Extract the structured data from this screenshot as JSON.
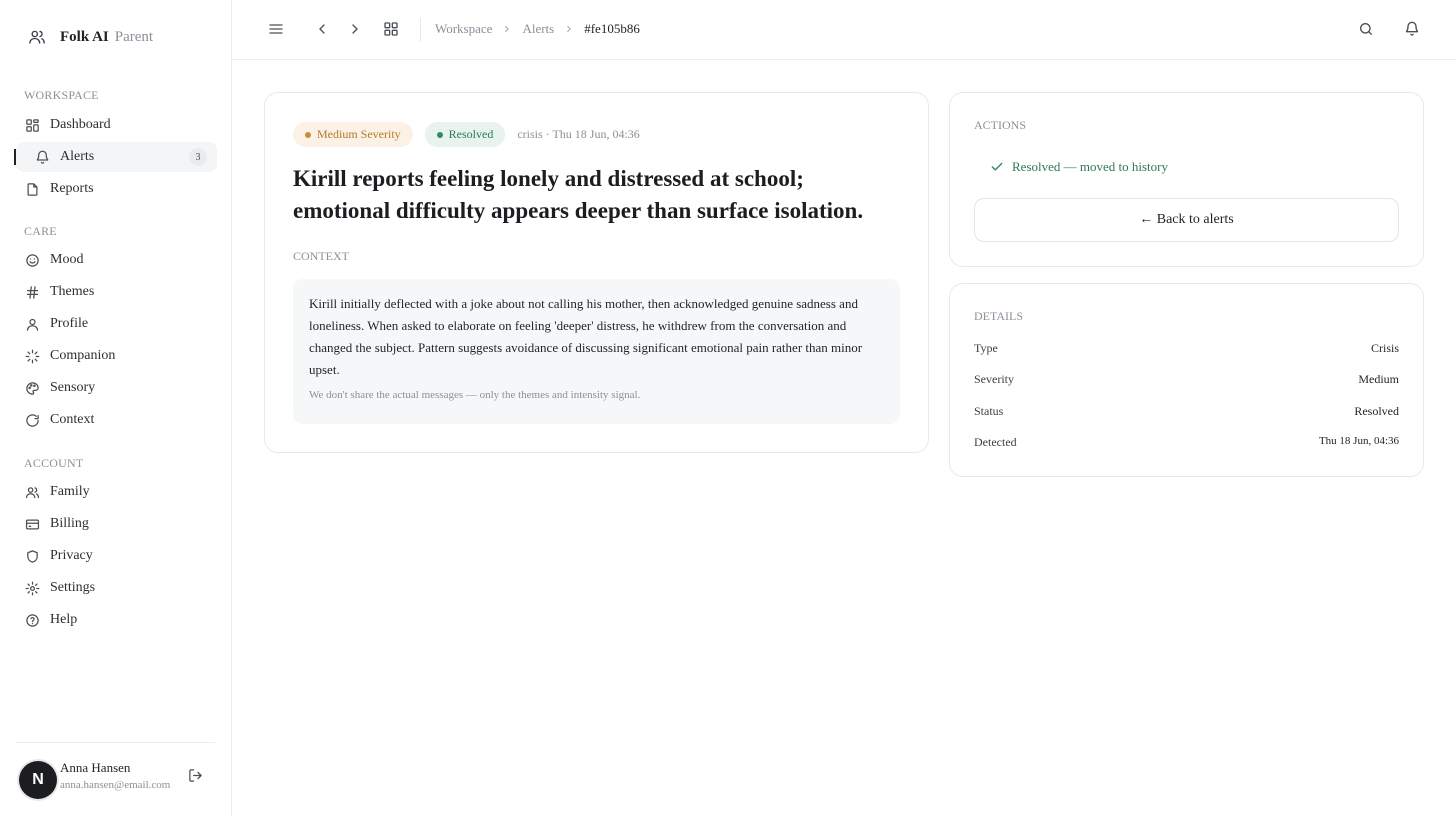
{
  "brand": {
    "name": "Folk AI",
    "role": "Parent",
    "icon": "users-icon"
  },
  "sidebar": {
    "sections": {
      "workspace": "WORKSPACE",
      "care": "CARE",
      "account": "ACCOUNT"
    },
    "items": [
      {
        "label": "Dashboard",
        "icon": "grid-icon"
      },
      {
        "label": "Alerts",
        "icon": "bell-icon",
        "badge": "3",
        "active": true
      },
      {
        "label": "Reports",
        "icon": "file-icon"
      },
      {
        "label": "Mood",
        "icon": "smile-icon"
      },
      {
        "label": "Themes",
        "icon": "hash-icon"
      },
      {
        "label": "Profile",
        "icon": "user-icon"
      },
      {
        "label": "Companion",
        "icon": "loader-icon"
      },
      {
        "label": "Sensory",
        "icon": "palette-icon"
      },
      {
        "label": "Context",
        "icon": "circle-icon"
      },
      {
        "label": "Family",
        "icon": "users-icon"
      },
      {
        "label": "Billing",
        "icon": "credit-card-icon"
      },
      {
        "label": "Privacy",
        "icon": "shield-icon"
      },
      {
        "label": "Settings",
        "icon": "gear-icon"
      },
      {
        "label": "Help",
        "icon": "help-circle-icon"
      }
    ]
  },
  "user": {
    "initial": "N",
    "name": "Anna Hansen",
    "email": "anna.hansen@email.com"
  },
  "topbar": {
    "breadcrumbs": [
      "Workspace",
      "Alerts",
      "#fe105b86"
    ]
  },
  "alert": {
    "severity_label": "Medium Severity",
    "status_label": "Resolved",
    "meta": "crisis · Thu 18 Jun, 04:36",
    "title": "Kirill reports feeling lonely and distressed at school; emotional difficulty appears deeper than surface isolation.",
    "context_label": "CONTEXT",
    "context_text": "Kirill initially deflected with a joke about not calling his mother, then acknowledged genuine sadness and loneliness. When asked to elaborate on feeling 'deeper' distress, he withdrew from the conversation and changed the subject. Pattern suggests avoidance of discussing significant emotional pain rather than minor upset.",
    "privacy_note": "We don't share the actual messages — only the themes and intensity signal."
  },
  "actions": {
    "label": "ACTIONS",
    "resolved_text": "Resolved — moved to history",
    "back_button": "← Back to alerts"
  },
  "details": {
    "label": "DETAILS",
    "rows": [
      {
        "key": "Type",
        "value": "Crisis"
      },
      {
        "key": "Severity",
        "value": "Medium"
      },
      {
        "key": "Status",
        "value": "Resolved"
      },
      {
        "key": "Detected",
        "value": "Thu 18 Jun, 04:36"
      }
    ]
  },
  "colors": {
    "medium": "#cf8b37",
    "resolved": "#2f8a5c",
    "accent": "#1b1d20"
  }
}
